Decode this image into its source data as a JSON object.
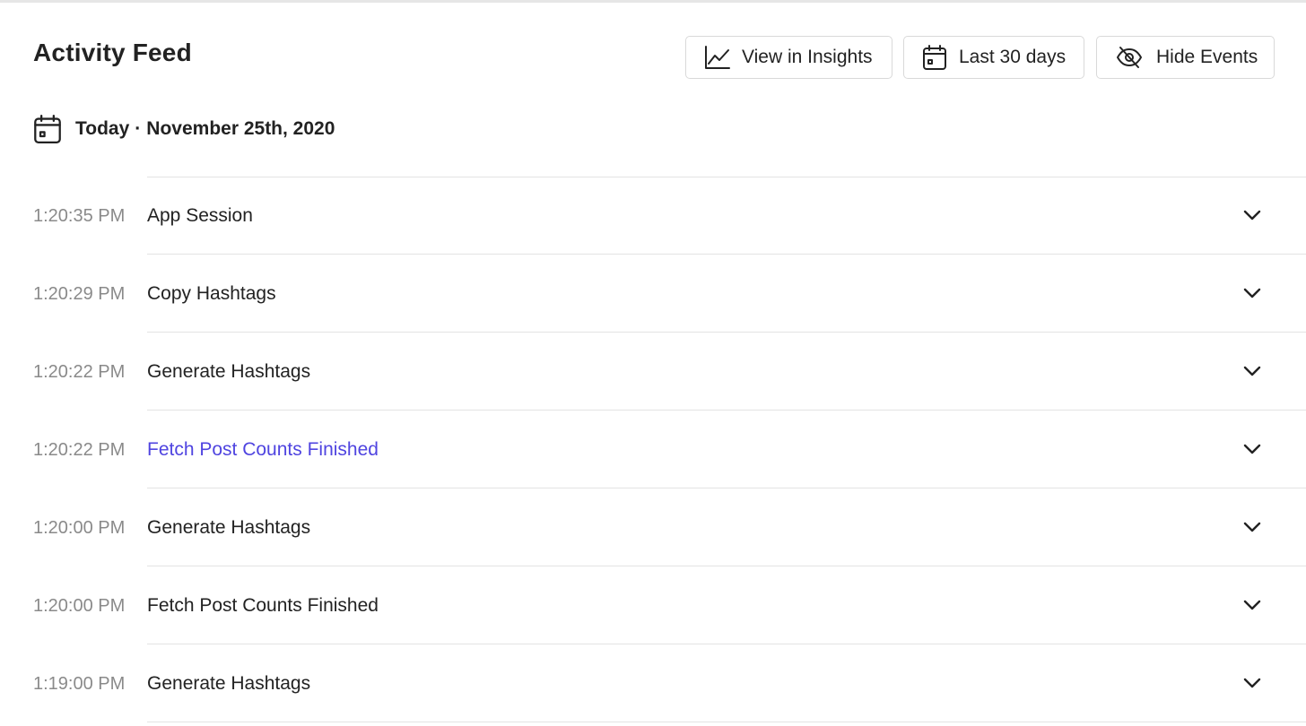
{
  "header": {
    "title": "Activity Feed"
  },
  "toolbar": {
    "insights_label": "View in Insights",
    "range_label": "Last 30 days",
    "hide_label": "Hide Events"
  },
  "date_group": {
    "day": "Today",
    "separator": "·",
    "date": "November 25th, 2020"
  },
  "events": [
    {
      "time": "1:20:35 PM",
      "name": "App Session",
      "highlighted": false
    },
    {
      "time": "1:20:29 PM",
      "name": "Copy Hashtags",
      "highlighted": false
    },
    {
      "time": "1:20:22 PM",
      "name": "Generate Hashtags",
      "highlighted": false
    },
    {
      "time": "1:20:22 PM",
      "name": "Fetch Post Counts Finished",
      "highlighted": true
    },
    {
      "time": "1:20:00 PM",
      "name": "Generate Hashtags",
      "highlighted": false
    },
    {
      "time": "1:20:00 PM",
      "name": "Fetch Post Counts Finished",
      "highlighted": false
    },
    {
      "time": "1:19:00 PM",
      "name": "Generate Hashtags",
      "highlighted": false
    }
  ],
  "icons": {
    "insights": "line-chart-icon",
    "range": "calendar-icon",
    "hide": "eye-slash-icon",
    "date": "calendar-icon",
    "expand": "chevron-down-icon"
  },
  "colors": {
    "highlight": "#4f44e0",
    "time": "#8a8a8a",
    "text": "#222222",
    "border": "#d9d9d9"
  }
}
